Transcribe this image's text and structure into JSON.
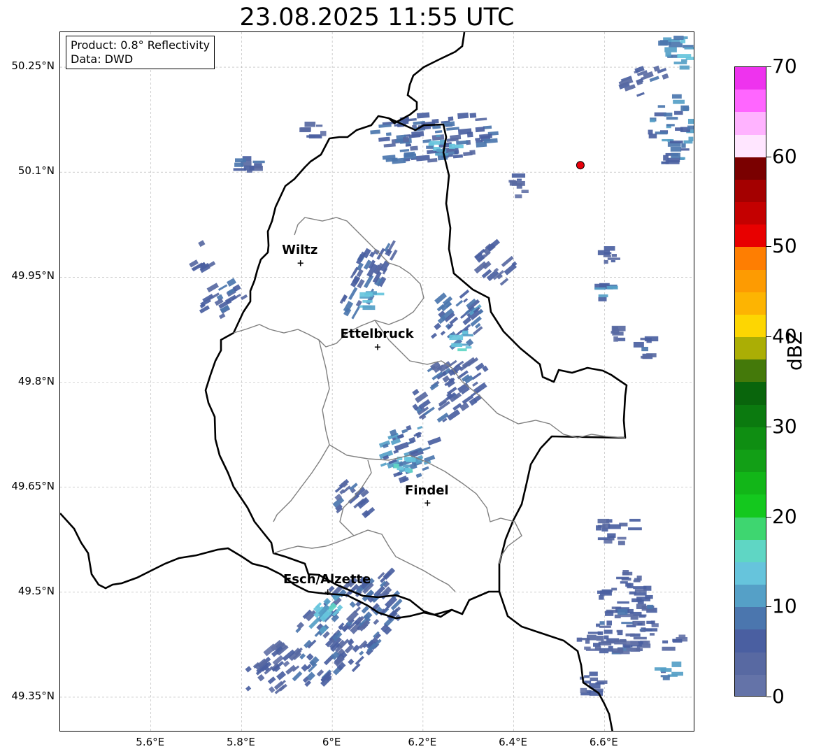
{
  "title": "23.08.2025 11:55 UTC",
  "info": {
    "product": "Product: 0.8° Reflectivity",
    "source": "Data: DWD"
  },
  "map": {
    "lon_range": [
      5.4,
      6.8
    ],
    "lat_range": [
      49.3,
      50.3
    ],
    "lat_ticks": [
      {
        "value": 50.25,
        "label": "50.25°N"
      },
      {
        "value": 50.1,
        "label": "50.1°N"
      },
      {
        "value": 49.95,
        "label": "49.95°N"
      },
      {
        "value": 49.8,
        "label": "49.8°N"
      },
      {
        "value": 49.65,
        "label": "49.65°N"
      },
      {
        "value": 49.5,
        "label": "49.5°N"
      },
      {
        "value": 49.35,
        "label": "49.35°N"
      }
    ],
    "lon_ticks": [
      {
        "value": 5.6,
        "label": "5.6°E"
      },
      {
        "value": 5.8,
        "label": "5.8°E"
      },
      {
        "value": 6.0,
        "label": "6°E"
      },
      {
        "value": 6.2,
        "label": "6.2°E"
      },
      {
        "value": 6.4,
        "label": "6.4°E"
      },
      {
        "value": 6.6,
        "label": "6.6°E"
      }
    ],
    "cities": [
      {
        "name": "Wiltz",
        "lon": 5.93,
        "lat": 49.97
      },
      {
        "name": "Ettelbruck",
        "lon": 6.1,
        "lat": 49.85
      },
      {
        "name": "Findel",
        "lon": 6.21,
        "lat": 49.627
      },
      {
        "name": "Esch/Alzette",
        "lon": 5.99,
        "lat": 49.5
      }
    ],
    "radar_site": {
      "lon": 6.547,
      "lat": 50.11,
      "color": "#e8000b"
    },
    "echo_clusters": [
      {
        "lon": 6.03,
        "lat": 49.45,
        "dlon": 0.16,
        "dlat": 0.055,
        "angle": -45,
        "dbz": 7
      },
      {
        "lon": 5.87,
        "lat": 49.39,
        "dlon": 0.07,
        "dlat": 0.03,
        "angle": -40,
        "dbz": 5
      },
      {
        "lon": 5.99,
        "lat": 49.47,
        "dlon": 0.05,
        "dlat": 0.02,
        "angle": -45,
        "dbz": 13
      },
      {
        "lon": 6.05,
        "lat": 49.63,
        "dlon": 0.04,
        "dlat": 0.03,
        "angle": -40,
        "dbz": 6
      },
      {
        "lon": 6.17,
        "lat": 49.7,
        "dlon": 0.07,
        "dlat": 0.04,
        "angle": -20,
        "dbz": 9
      },
      {
        "lon": 6.16,
        "lat": 49.685,
        "dlon": 0.02,
        "dlat": 0.015,
        "angle": 0,
        "dbz": 15
      },
      {
        "lon": 6.26,
        "lat": 49.79,
        "dlon": 0.09,
        "dlat": 0.04,
        "angle": -35,
        "dbz": 6
      },
      {
        "lon": 6.27,
        "lat": 49.89,
        "dlon": 0.06,
        "dlat": 0.04,
        "angle": -40,
        "dbz": 8
      },
      {
        "lon": 6.29,
        "lat": 49.86,
        "dlon": 0.02,
        "dlat": 0.015,
        "angle": 0,
        "dbz": 14
      },
      {
        "lon": 6.08,
        "lat": 49.95,
        "dlon": 0.09,
        "dlat": 0.025,
        "angle": -60,
        "dbz": 7
      },
      {
        "lon": 6.085,
        "lat": 49.92,
        "dlon": 0.02,
        "dlat": 0.015,
        "angle": 0,
        "dbz": 13
      },
      {
        "lon": 5.76,
        "lat": 49.92,
        "dlon": 0.05,
        "dlat": 0.025,
        "angle": -30,
        "dbz": 6
      },
      {
        "lon": 5.71,
        "lat": 49.98,
        "dlon": 0.025,
        "dlat": 0.02,
        "angle": -30,
        "dbz": 5
      },
      {
        "lon": 5.82,
        "lat": 50.11,
        "dlon": 0.04,
        "dlat": 0.015,
        "angle": 0,
        "dbz": 6
      },
      {
        "lon": 5.96,
        "lat": 50.16,
        "dlon": 0.025,
        "dlat": 0.012,
        "angle": 0,
        "dbz": 5
      },
      {
        "lon": 6.22,
        "lat": 50.15,
        "dlon": 0.15,
        "dlat": 0.035,
        "angle": -5,
        "dbz": 7
      },
      {
        "lon": 6.25,
        "lat": 50.14,
        "dlon": 0.04,
        "dlat": 0.015,
        "angle": 0,
        "dbz": 13
      },
      {
        "lon": 6.41,
        "lat": 50.08,
        "dlon": 0.025,
        "dlat": 0.02,
        "angle": 0,
        "dbz": 5
      },
      {
        "lon": 6.36,
        "lat": 49.97,
        "dlon": 0.04,
        "dlat": 0.03,
        "angle": -40,
        "dbz": 5
      },
      {
        "lon": 6.69,
        "lat": 50.23,
        "dlon": 0.05,
        "dlat": 0.02,
        "angle": -20,
        "dbz": 6
      },
      {
        "lon": 6.75,
        "lat": 50.16,
        "dlon": 0.05,
        "dlat": 0.05,
        "angle": 0,
        "dbz": 9
      },
      {
        "lon": 6.76,
        "lat": 50.27,
        "dlon": 0.04,
        "dlat": 0.03,
        "angle": 0,
        "dbz": 12
      },
      {
        "lon": 6.61,
        "lat": 49.98,
        "dlon": 0.015,
        "dlat": 0.015,
        "angle": 0,
        "dbz": 5
      },
      {
        "lon": 6.6,
        "lat": 49.93,
        "dlon": 0.02,
        "dlat": 0.012,
        "angle": 0,
        "dbz": 10
      },
      {
        "lon": 6.69,
        "lat": 49.85,
        "dlon": 0.02,
        "dlat": 0.025,
        "angle": 0,
        "dbz": 6
      },
      {
        "lon": 6.63,
        "lat": 49.87,
        "dlon": 0.012,
        "dlat": 0.01,
        "angle": 0,
        "dbz": 5
      },
      {
        "lon": 6.63,
        "lat": 49.59,
        "dlon": 0.05,
        "dlat": 0.02,
        "angle": 0,
        "dbz": 5
      },
      {
        "lon": 6.65,
        "lat": 49.47,
        "dlon": 0.07,
        "dlat": 0.06,
        "angle": 0,
        "dbz": 6
      },
      {
        "lon": 6.66,
        "lat": 49.43,
        "dlon": 0.12,
        "dlat": 0.02,
        "angle": 0,
        "dbz": 5
      },
      {
        "lon": 6.74,
        "lat": 49.39,
        "dlon": 0.03,
        "dlat": 0.015,
        "angle": 0,
        "dbz": 9
      },
      {
        "lon": 6.58,
        "lat": 49.37,
        "dlon": 0.04,
        "dlat": 0.02,
        "angle": 0,
        "dbz": 5
      }
    ]
  },
  "colorbar": {
    "label": "dBZ",
    "min": 0,
    "max": 70,
    "step": 2.5,
    "colors": [
      "#6473a8",
      "#5869a2",
      "#4a5fa1",
      "#4b76ae",
      "#55a0c7",
      "#66c4dc",
      "#5fd6c4",
      "#3ed670",
      "#14c81e",
      "#12b618",
      "#129f16",
      "#0f8e12",
      "#0b7a0f",
      "#09650c",
      "#44790a",
      "#abae05",
      "#fdd602",
      "#fdb402",
      "#fd9b02",
      "#fe7e02",
      "#e80000",
      "#c40000",
      "#a40000",
      "#7a0000",
      "#ffe6ff",
      "#ffb3ff",
      "#ff66ff",
      "#ee33ee"
    ],
    "ticks": [
      {
        "value": 0,
        "label": "0"
      },
      {
        "value": 10,
        "label": "10"
      },
      {
        "value": 20,
        "label": "20"
      },
      {
        "value": 30,
        "label": "30"
      },
      {
        "value": 40,
        "label": "40"
      },
      {
        "value": 50,
        "label": "50"
      },
      {
        "value": 60,
        "label": "60"
      },
      {
        "value": 70,
        "label": "70"
      }
    ]
  }
}
